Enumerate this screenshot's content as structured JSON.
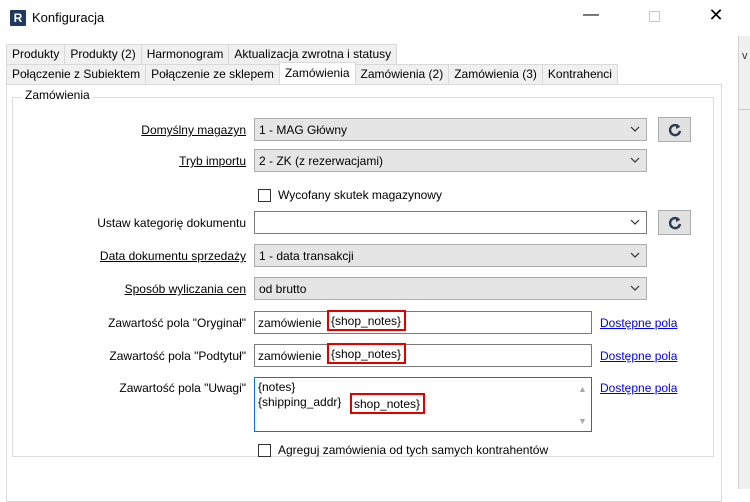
{
  "window": {
    "app_icon": "R",
    "title": "Konfiguracja",
    "minimize": "—",
    "close": "✕"
  },
  "right_strip_text": "v",
  "tabs_row1": [
    "Produkty",
    "Produkty (2)",
    "Harmonogram",
    "Aktualizacja zwrotna i statusy"
  ],
  "tabs_row2": [
    "Połączenie z Subiektem",
    "Połączenie ze sklepem",
    "Zamówienia",
    "Zamówienia (2)",
    "Zamówienia (3)",
    "Kontrahenci"
  ],
  "active_tab": "Zamówienia",
  "group": {
    "title": "Zamówienia"
  },
  "fields": {
    "magazyn_label": "Domyślny magazyn",
    "magazyn_value": "1 - MAG Główny",
    "tryb_label": "Tryb importu",
    "tryb_value": "2 - ZK (z rezerwacjami)",
    "wycofany_label": "Wycofany skutek magazynowy",
    "kategoria_label": "Ustaw kategorię dokumentu",
    "kategoria_value": "",
    "data_label": "Data dokumentu sprzedaży",
    "data_value": "1 - data transakcji",
    "ceny_label": "Sposób wyliczania cen",
    "ceny_value": "od brutto",
    "oryginal_label": "Zawartość pola \"Oryginał\"",
    "oryginal_prefix": "zamówienie",
    "oryginal_token": "{shop_notes}",
    "podtytul_label": "Zawartość pola \"Podtytuł\"",
    "podtytul_prefix": "zamówienie",
    "podtytul_token": "{shop_notes}",
    "uwagi_label": "Zawartość pola \"Uwagi\"",
    "uwagi_line1": "{notes}",
    "uwagi_line2_prefix": "{shipping_addr}",
    "uwagi_token": "shop_notes}",
    "dostepne_link": "Dostępne pola",
    "agreguj_label": "Agreguj zamówienia od tych samych kontrahentów"
  },
  "colors": {
    "highlight": "#e00000",
    "link": "#0000ee",
    "focus": "#0078d7"
  }
}
